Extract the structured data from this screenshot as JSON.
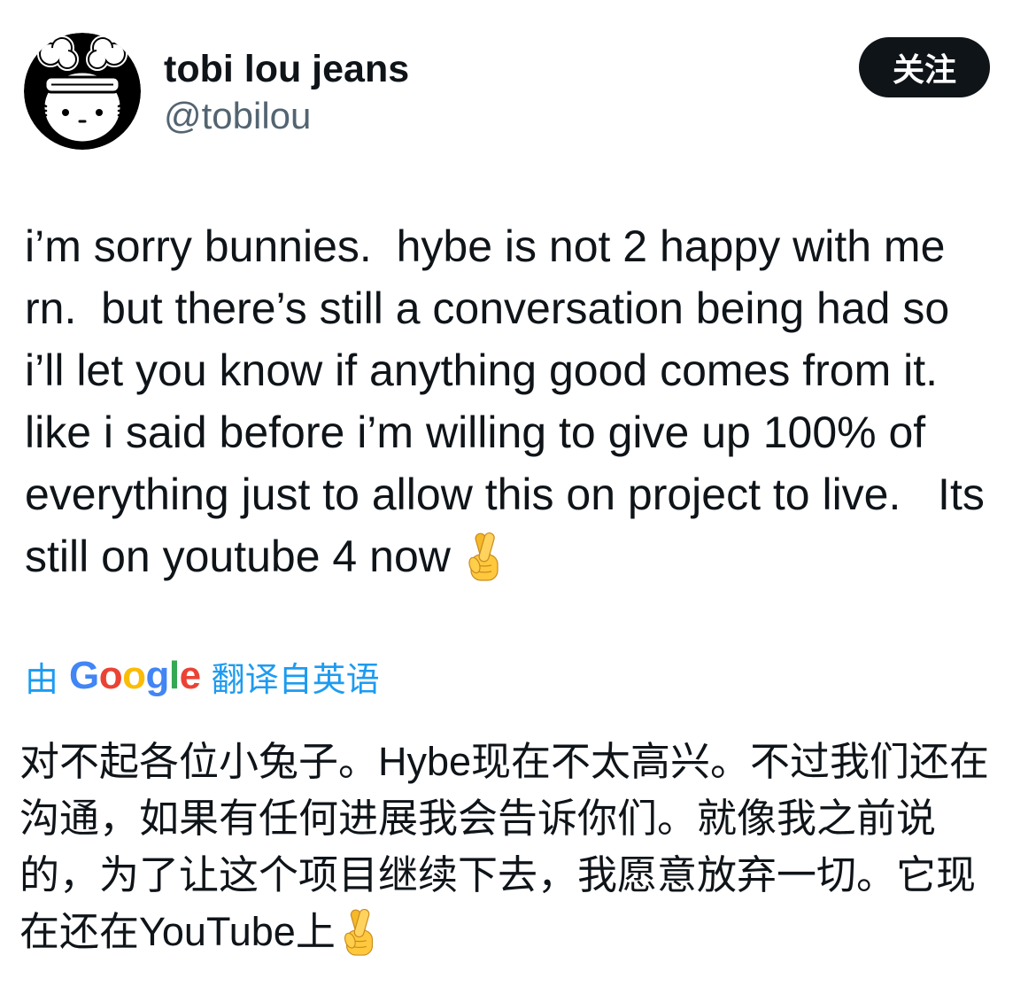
{
  "author": {
    "display_name": "tobi lou jeans",
    "handle": "@tobilou",
    "avatar_icon": "cartoon-face-avatar"
  },
  "follow_button": {
    "label": "关注"
  },
  "tweet": {
    "lines": [
      "i’m sorry bunnies.  hybe is not 2 happy with me",
      "rn.  but there’s still a conversation being had so",
      "i’ll let you know if anything good comes from it.",
      "like i said before i’m willing to give up 100% of",
      "everything just to allow this on project to live.   Its",
      "still on youtube 4 now"
    ],
    "trailing_emoji": "crossed-fingers-emoji"
  },
  "translation_bar": {
    "prefix": "由",
    "logo_letters": [
      "G",
      "o",
      "o",
      "g",
      "l",
      "e"
    ],
    "logo_colors": [
      "#4285F4",
      "#EA4335",
      "#FBBC05",
      "#4285F4",
      "#34A853",
      "#EA4335"
    ],
    "suffix": "翻译自英语"
  },
  "translation": {
    "lines": [
      "对不起各位小兔子。Hybe现在不太高兴。不过我们还在",
      "沟通，如果有任何进展我会告诉你们。就像我之前说",
      "的，为了让这个项目继续下去，我愿意放弃一切。它现",
      "在还在YouTube上"
    ],
    "trailing_emoji": "crossed-fingers-emoji"
  },
  "colors": {
    "text": "#0f1419",
    "secondary": "#536471",
    "link": "#1d9bf0",
    "button_bg": "#0f1419",
    "button_text": "#ffffff",
    "emoji_fill": "#FFC83D"
  }
}
